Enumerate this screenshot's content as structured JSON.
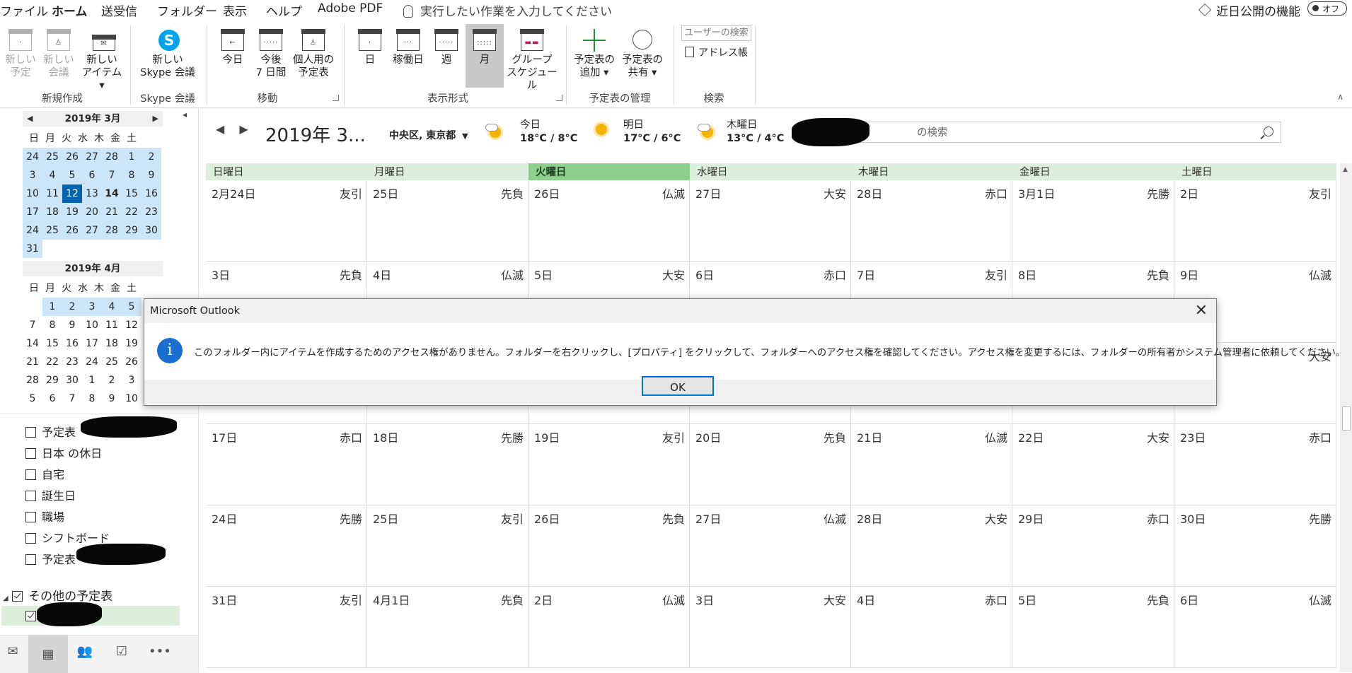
{
  "tabs": [
    "ファイル",
    "ホーム",
    "送受信",
    "フォルダー",
    "表示",
    "ヘルプ",
    "Adobe PDF"
  ],
  "tell_me": "実行したい作業を入力してください",
  "coming_soon": "近日公開の機能",
  "toggle_label": "オフ",
  "ribbon": {
    "new_appt": [
      "新しい",
      "予定"
    ],
    "new_meeting": [
      "新しい",
      "会議"
    ],
    "new_items": [
      "新しい",
      "アイテム ▾"
    ],
    "skype": [
      "新しい",
      "Skype 会議"
    ],
    "today": [
      "今日"
    ],
    "next7": [
      "今後",
      "7 日間"
    ],
    "personal": [
      "個人用の",
      "予定表"
    ],
    "day": [
      "日"
    ],
    "workweek": [
      "稼働日"
    ],
    "week": [
      "週"
    ],
    "month": [
      "月"
    ],
    "group": [
      "グループ",
      "スケジュール"
    ],
    "add_cal": [
      "予定表の",
      "追加 ▾"
    ],
    "share_cal": [
      "予定表の",
      "共有 ▾"
    ],
    "user_search": "ユーザーの検索",
    "address_book": "アドレス帳",
    "groups": [
      "新規作成",
      "Skype 会議",
      "移動",
      "表示形式",
      "予定表の管理",
      "検索"
    ]
  },
  "mini_march": {
    "title": "2019年 3月",
    "weekdays": [
      "日",
      "月",
      "火",
      "水",
      "木",
      "金",
      "土"
    ],
    "weeks": [
      [
        "24",
        "25",
        "26",
        "27",
        "28",
        "1",
        "2"
      ],
      [
        "3",
        "4",
        "5",
        "6",
        "7",
        "8",
        "9"
      ],
      [
        "10",
        "11",
        "12",
        "13",
        "14",
        "15",
        "16"
      ],
      [
        "17",
        "18",
        "19",
        "20",
        "21",
        "22",
        "23"
      ],
      [
        "24",
        "25",
        "26",
        "27",
        "28",
        "29",
        "30"
      ],
      [
        "31"
      ]
    ]
  },
  "mini_april": {
    "title": "2019年 4月",
    "weekdays": [
      "日",
      "月",
      "火",
      "水",
      "木",
      "金",
      "土"
    ],
    "weeks": [
      [
        "",
        "1",
        "2",
        "3",
        "4",
        "5",
        ""
      ],
      [
        "7",
        "8",
        "9",
        "10",
        "11",
        "12",
        ""
      ],
      [
        "14",
        "15",
        "16",
        "17",
        "18",
        "19",
        ""
      ],
      [
        "21",
        "22",
        "23",
        "24",
        "25",
        "26",
        ""
      ],
      [
        "28",
        "29",
        "30",
        "1",
        "2",
        "3",
        ""
      ],
      [
        "5",
        "6",
        "7",
        "8",
        "9",
        "10",
        ""
      ]
    ]
  },
  "calendars": [
    "予定表",
    "日本 の休日",
    "自宅",
    "誕生日",
    "職場",
    "シフトボード",
    "予定表"
  ],
  "other_calendars": "その他の予定表",
  "header": {
    "title": "2019年 3...",
    "location": "中央区, 東京都",
    "weather": [
      {
        "day": "今日",
        "temp": "18°C / 8°C"
      },
      {
        "day": "明日",
        "temp": "17°C / 6°C"
      },
      {
        "day": "木曜日",
        "temp": "13°C / 4°C"
      }
    ],
    "search_placeholder": "の検索"
  },
  "weekday_headers": [
    "日曜日",
    "月曜日",
    "火曜日",
    "水曜日",
    "木曜日",
    "金曜日",
    "土曜日"
  ],
  "weeks": [
    [
      [
        "2月24日",
        "友引"
      ],
      [
        "25日",
        "先負"
      ],
      [
        "26日",
        "仏滅"
      ],
      [
        "27日",
        "大安"
      ],
      [
        "28日",
        "赤口"
      ],
      [
        "3月1日",
        "先勝"
      ],
      [
        "2日",
        "友引"
      ]
    ],
    [
      [
        "3日",
        "先負"
      ],
      [
        "4日",
        "仏滅"
      ],
      [
        "5日",
        "大安"
      ],
      [
        "6日",
        "赤口"
      ],
      [
        "7日",
        "友引"
      ],
      [
        "8日",
        "先負"
      ],
      [
        "9日",
        "仏滅"
      ]
    ],
    [
      [
        "",
        "",
        ""
      ],
      [
        "",
        "",
        ""
      ],
      [
        "",
        "",
        ""
      ],
      [
        "",
        "",
        ""
      ],
      [
        "",
        "",
        ""
      ],
      [
        "",
        "",
        ""
      ],
      [
        "",
        "大安"
      ]
    ],
    [
      [
        "17日",
        "赤口"
      ],
      [
        "18日",
        "先勝"
      ],
      [
        "19日",
        "友引"
      ],
      [
        "20日",
        "先負"
      ],
      [
        "21日",
        "仏滅"
      ],
      [
        "22日",
        "大安"
      ],
      [
        "23日",
        "赤口"
      ]
    ],
    [
      [
        "24日",
        "先勝"
      ],
      [
        "25日",
        "友引"
      ],
      [
        "26日",
        "先負"
      ],
      [
        "27日",
        "仏滅"
      ],
      [
        "28日",
        "大安"
      ],
      [
        "29日",
        "赤口"
      ],
      [
        "30日",
        "先勝"
      ]
    ],
    [
      [
        "31日",
        "友引"
      ],
      [
        "4月1日",
        "先負"
      ],
      [
        "2日",
        "仏滅"
      ],
      [
        "3日",
        "大安"
      ],
      [
        "4日",
        "赤口"
      ],
      [
        "5日",
        "先負"
      ],
      [
        "6日",
        "仏滅"
      ]
    ]
  ],
  "dialog": {
    "title": "Microsoft Outlook",
    "message": "このフォルダー内にアイテムを作成するためのアクセス権がありません。フォルダーを右クリックし、[プロパティ] をクリックして、フォルダーへのアクセス権を確認してください。アクセス権を変更するには、フォルダーの所有者かシステム管理者に依頼してください。",
    "ok": "OK"
  }
}
